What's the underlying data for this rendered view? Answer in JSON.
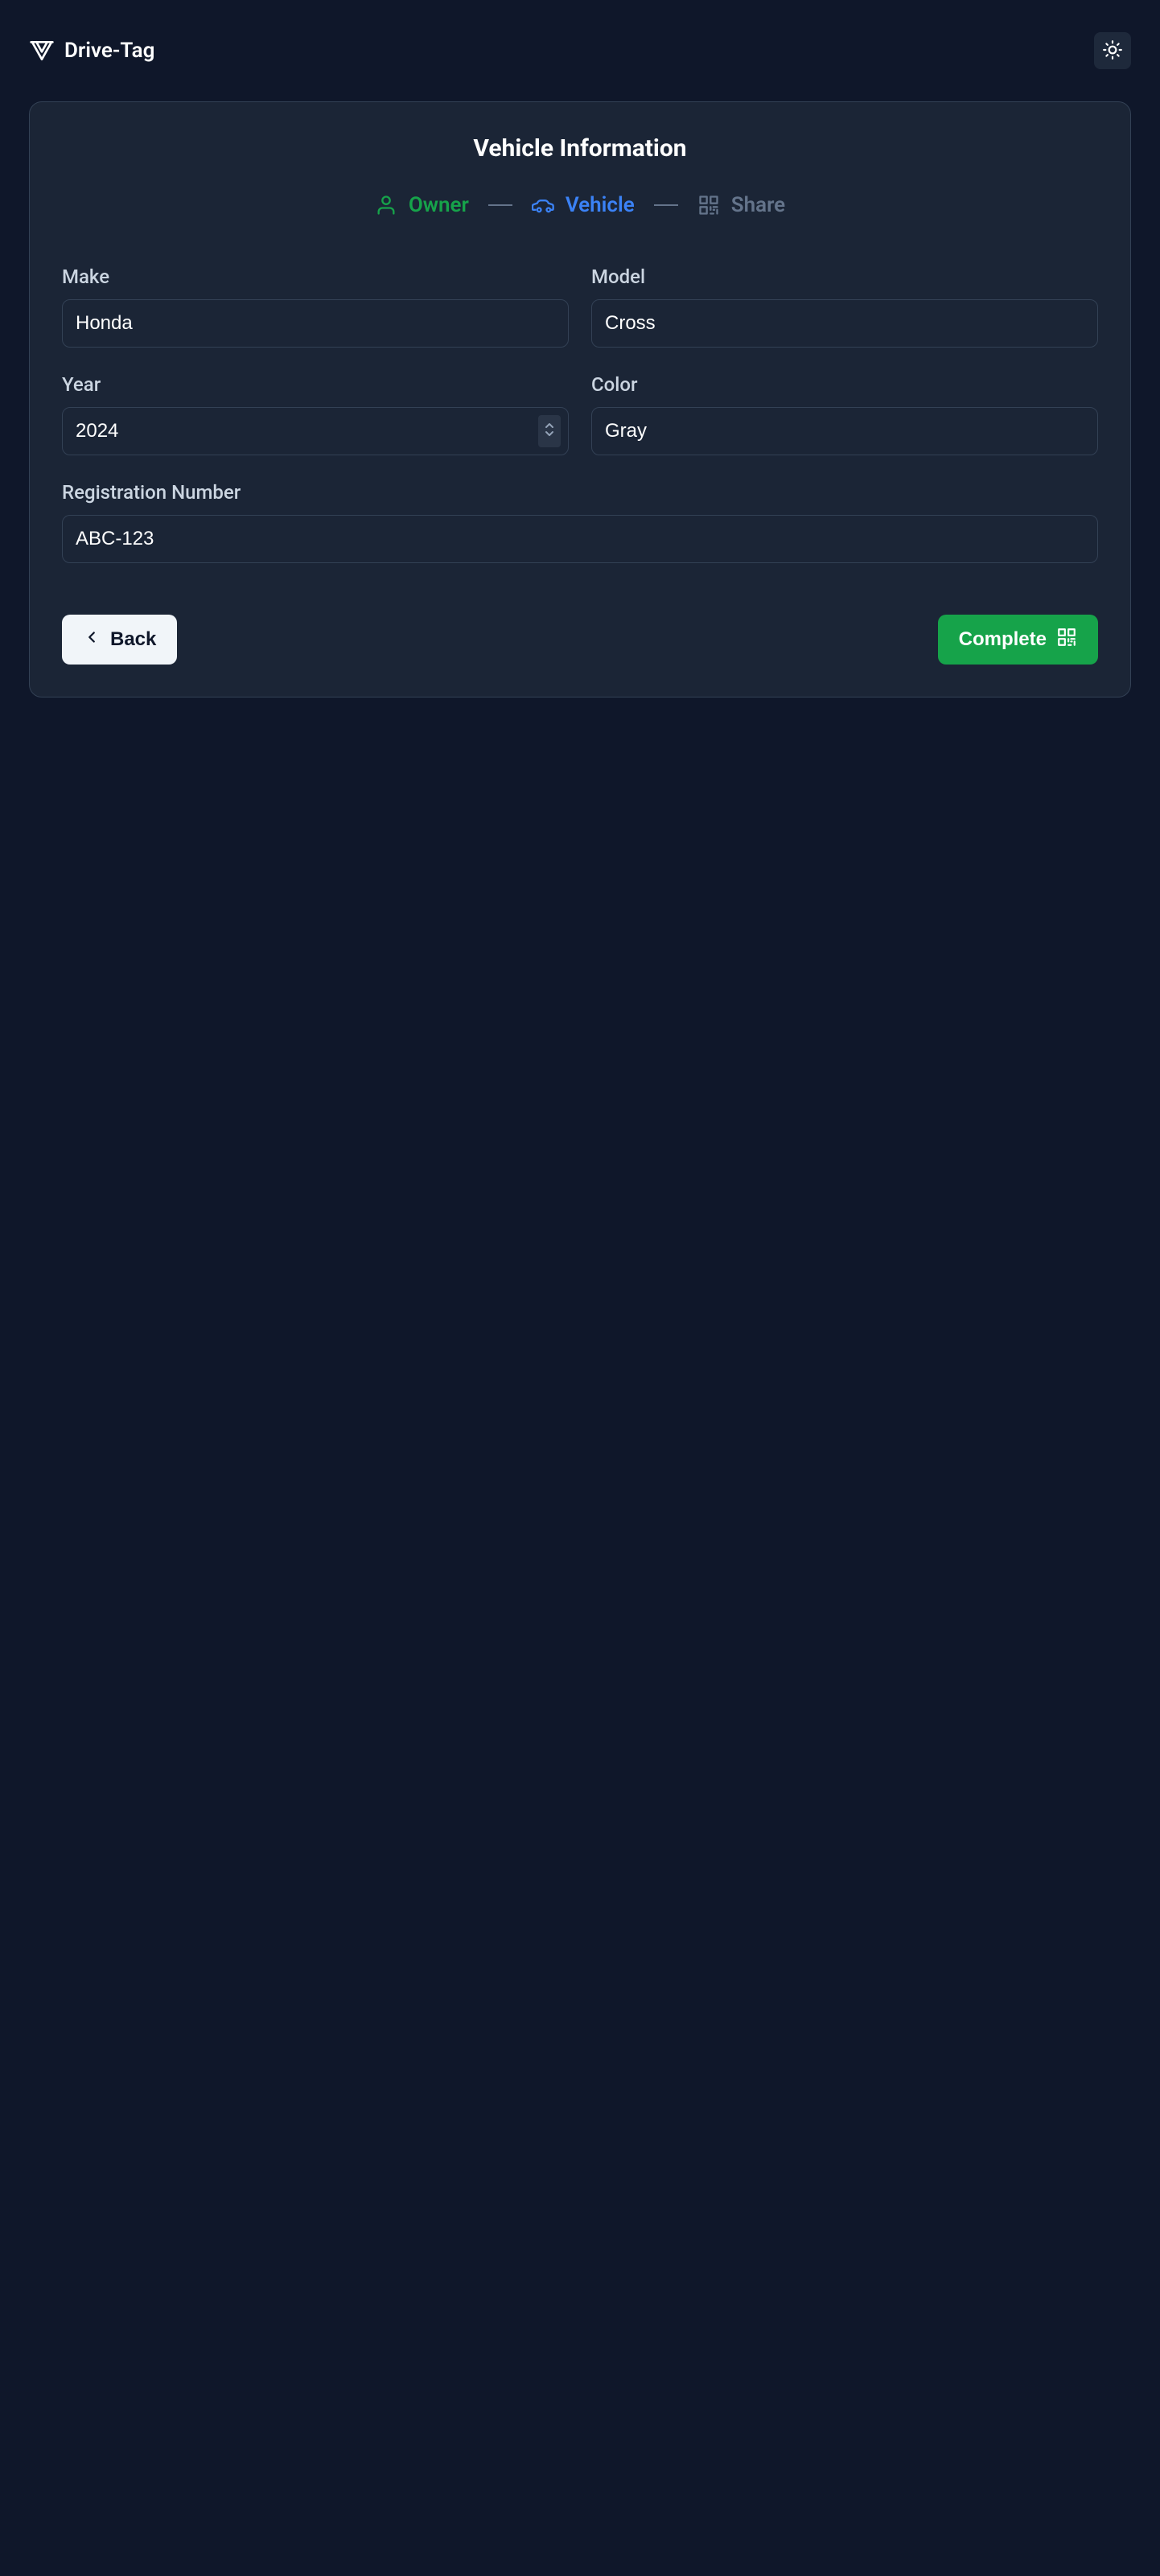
{
  "header": {
    "brand": "Drive-Tag"
  },
  "card": {
    "title": "Vehicle Information"
  },
  "stepper": {
    "owner": "Owner",
    "vehicle": "Vehicle",
    "share": "Share"
  },
  "form": {
    "make": {
      "label": "Make",
      "value": "Honda"
    },
    "model": {
      "label": "Model",
      "value": "Cross"
    },
    "year": {
      "label": "Year",
      "value": "2024"
    },
    "color": {
      "label": "Color",
      "value": "Gray"
    },
    "registration": {
      "label": "Registration Number",
      "value": "ABC-123"
    }
  },
  "actions": {
    "back": "Back",
    "complete": "Complete"
  }
}
